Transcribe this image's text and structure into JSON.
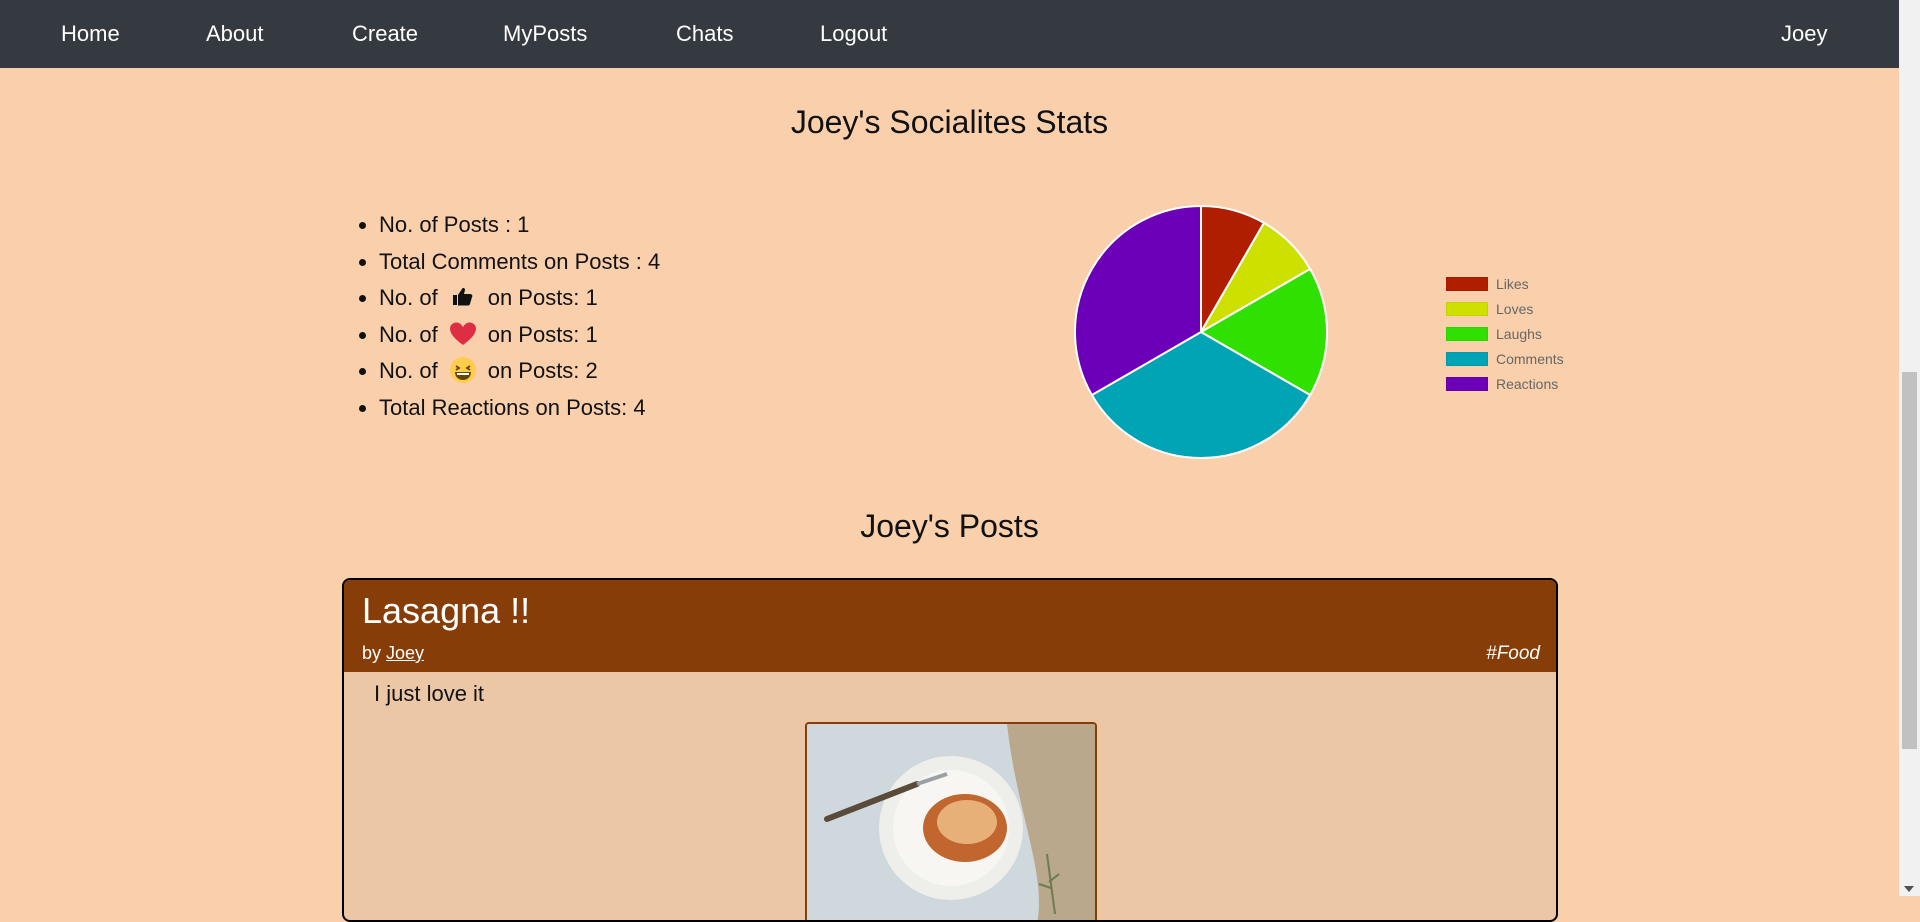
{
  "nav": {
    "items": [
      "Home",
      "About",
      "Create",
      "MyPosts",
      "Chats",
      "Logout"
    ],
    "user": "Joey"
  },
  "stats": {
    "title": "Joey's Socialites Stats",
    "lines": {
      "posts": "No. of Posts : 1",
      "comments": "Total Comments on Posts : 4",
      "likes_prefix": "No. of",
      "likes_suffix": "on Posts: 1",
      "loves_prefix": "No. of",
      "loves_suffix": "on Posts: 1",
      "laughs_prefix": "No. of",
      "laughs_suffix": "on Posts: 2",
      "reactions": "Total Reactions on Posts: 4"
    },
    "icons": [
      "thumbs-up-icon",
      "heart-icon",
      "laughing-face-icon"
    ]
  },
  "chart_data": {
    "type": "pie",
    "categories": [
      "Likes",
      "Loves",
      "Laughs",
      "Comments",
      "Reactions"
    ],
    "values": [
      1,
      1,
      2,
      4,
      4
    ],
    "colors": [
      "#b01e00",
      "#cde000",
      "#2fe000",
      "#00a4b5",
      "#6c00b8"
    ],
    "legend": "right"
  },
  "posts": {
    "title": "Joey's Posts",
    "items": [
      {
        "title": "Lasagna !!",
        "by_label": "by",
        "author": "Joey",
        "tag": "#Food",
        "body": "I just love it",
        "image": "lasagna-photo"
      }
    ]
  }
}
